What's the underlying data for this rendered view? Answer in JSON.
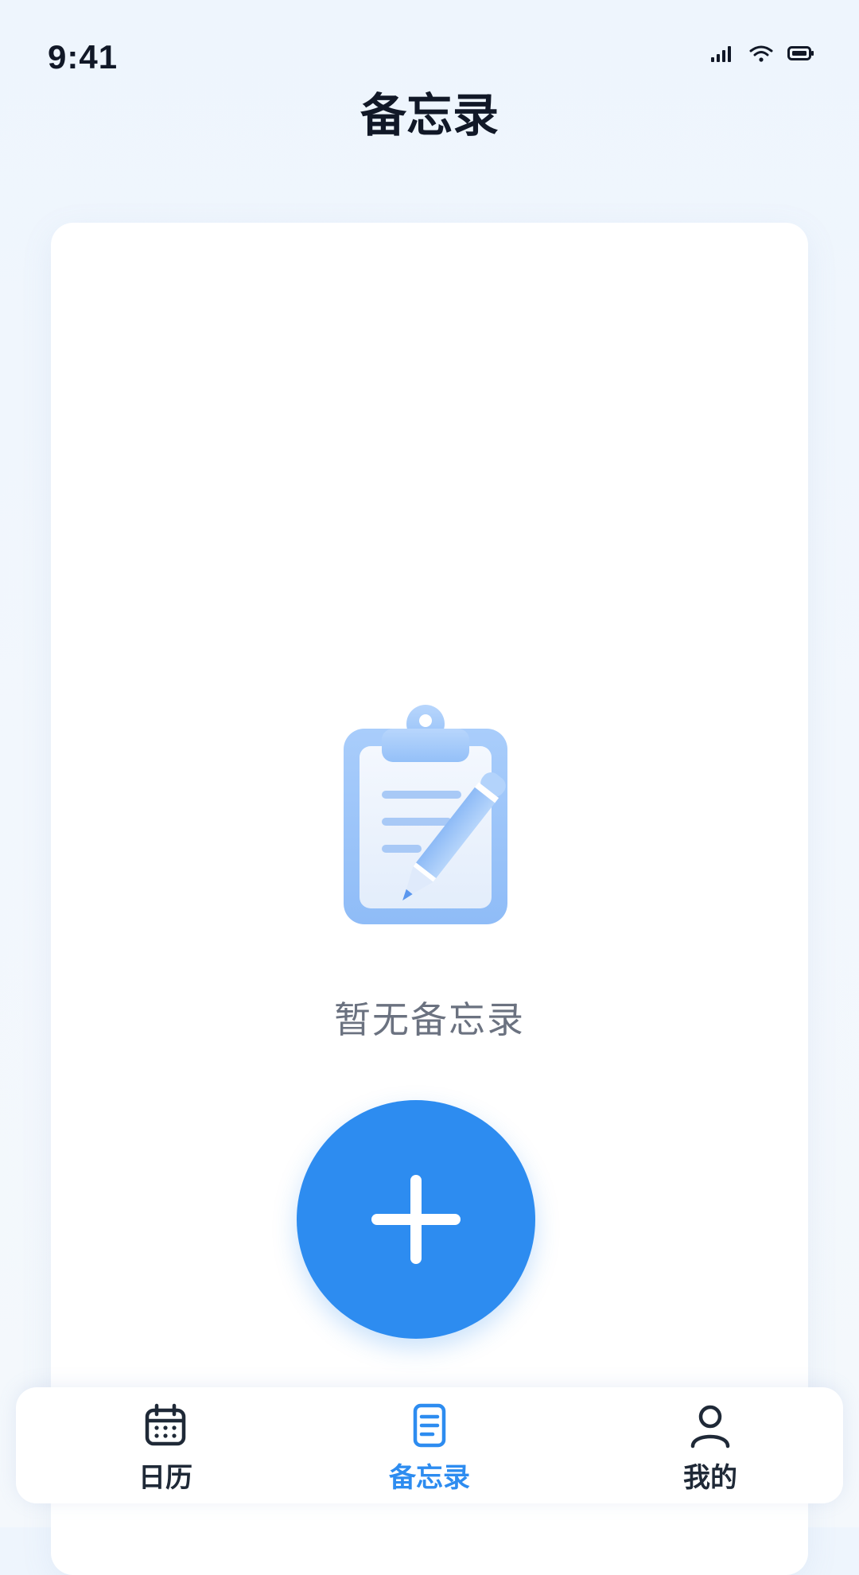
{
  "status_bar": {
    "time": "9:41",
    "icons": [
      "signal-icon",
      "wifi-icon",
      "battery-icon"
    ]
  },
  "header": {
    "title": "备忘录"
  },
  "main": {
    "empty_state": {
      "illustration": "clipboard-pencil-icon",
      "message": "暂无备忘录"
    },
    "add_button": {
      "icon": "plus-icon"
    }
  },
  "tab_bar": {
    "items": [
      {
        "label": "日历",
        "icon": "calendar-icon",
        "active": false
      },
      {
        "label": "备忘录",
        "icon": "document-icon",
        "active": true
      },
      {
        "label": "我的",
        "icon": "user-icon",
        "active": false
      }
    ]
  },
  "colors": {
    "accent": "#2d8cf0",
    "title_text": "#111827",
    "muted_text": "#6b7280",
    "background": "#eef5fd",
    "card": "#ffffff"
  }
}
